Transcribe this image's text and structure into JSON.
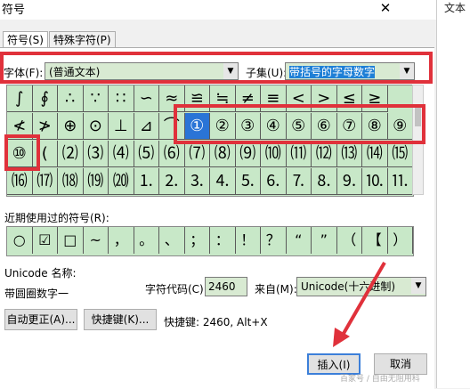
{
  "dialog": {
    "title": "符号",
    "close": "✕"
  },
  "right_pane": {
    "text": "文本"
  },
  "tabs": [
    "符号(S)",
    "特殊字符(P)"
  ],
  "font": {
    "label": "字体(F):",
    "value": "(普通文本)"
  },
  "subset": {
    "label": "子集(U):",
    "value": "带括号的字母数字"
  },
  "grid": {
    "rows": [
      [
        "∫",
        "∮",
        "∴",
        "∵",
        "∷",
        "∽",
        "≈",
        "≌",
        "≒",
        "≠",
        "≡",
        "<",
        ">",
        "≤",
        "≥"
      ],
      [
        "≮",
        "≯",
        "⊕",
        "⊙",
        "⊥",
        "⊿",
        "⌒",
        "①",
        "②",
        "③",
        "④",
        "⑤",
        "⑥",
        "⑦",
        "⑧",
        "⑨"
      ],
      [
        "⑩",
        "(",
        "⑵",
        "⑶",
        "⑷",
        "⑸",
        "⑹",
        "⑺",
        "⑻",
        "⑼",
        "⑽",
        "⑾",
        "⑿",
        "⒀",
        "⒁",
        "⒂"
      ],
      [
        "⒃",
        "⒄",
        "⒅",
        "⒆",
        "⒇",
        "⒈",
        "⒉",
        "⒊",
        "⒋",
        "⒌",
        "⒍",
        "⒎",
        "⒏",
        "⒐",
        "⒑",
        "⒒"
      ]
    ]
  },
  "recent": {
    "label": "近期使用过的符号(R):",
    "items": [
      "○",
      "☑",
      "□",
      "~",
      "，",
      "。",
      "、",
      "；",
      "：",
      "！",
      "？",
      "“",
      "”",
      "（",
      "【",
      "）"
    ]
  },
  "unicode": {
    "name_label": "Unicode 名称:",
    "name_value": "带圆圈数字一"
  },
  "charcode": {
    "label": "字符代码(C):",
    "value": "2460"
  },
  "from": {
    "label": "来自(M):",
    "value": "Unicode(十六进制)"
  },
  "buttons": {
    "autocorrect": "自动更正(A)...",
    "shortcut_key": "快捷键(K)...",
    "insert": "插入(I)",
    "cancel": "取消"
  },
  "shortcut_text": "快捷键: 2460, Alt+X",
  "watermark": "百家号 / 自由无阻用科"
}
